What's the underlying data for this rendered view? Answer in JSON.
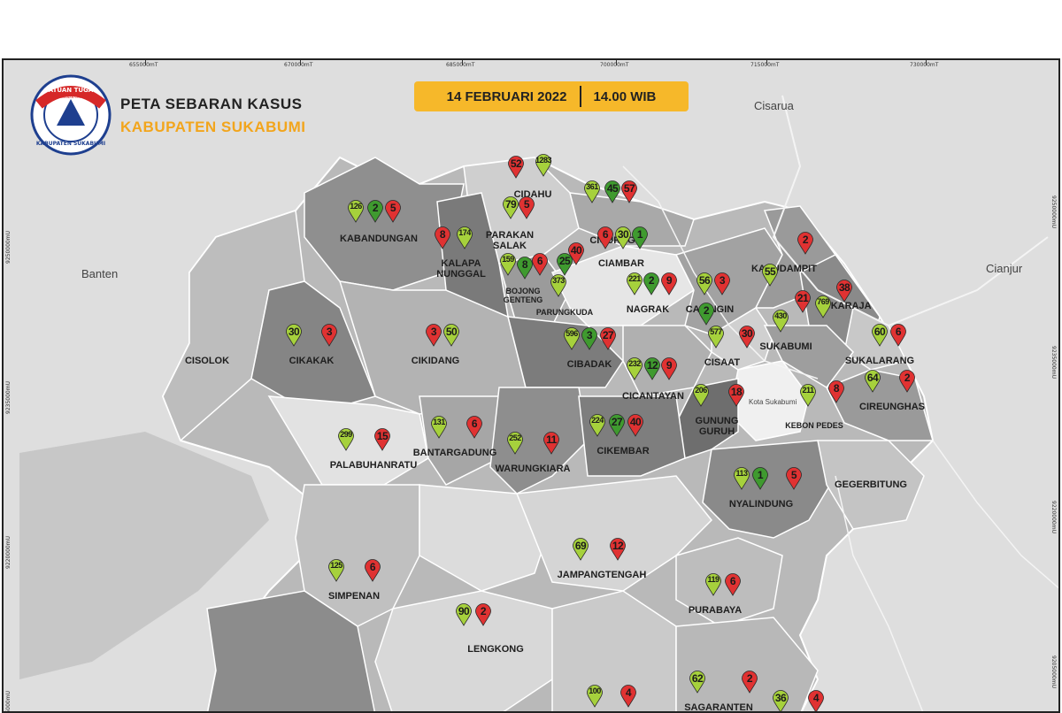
{
  "header": {
    "title": "PETA SEBARAN KASUS",
    "subtitle": "KABUPATEN SUKABUMI",
    "date": "14 FEBRUARI 2022",
    "time": "14.00 WIB"
  },
  "logo": {
    "ring_top": "SATUAN TUGAS",
    "ring_inner": "PENANGANAN COVID-19",
    "ring_bottom": "KABUPATEN SUKABUMI",
    "icon": "triangle-emblem-icon"
  },
  "grid_labels": {
    "top": [
      "655000mT",
      "670000mT",
      "685000mT",
      "700000mT",
      "715000mT",
      "730000mT"
    ],
    "left": [
      "9250000mU",
      "9235000mU",
      "9220000mU",
      "9205000mU"
    ],
    "right": [
      "9250000mU",
      "9235000mU",
      "9220000mU",
      "9205000mU"
    ]
  },
  "places": {
    "banten": "Banten",
    "cisarua": "Cisarua",
    "cianjur": "Cianjur",
    "kota_sukabumi": "Kota Sukabumi"
  },
  "legend_colors": {
    "green_light": "#a6d13c",
    "green_dark": "#3f9a2f",
    "red": "#e03232"
  },
  "districts": [
    {
      "name": "CIDAHU",
      "pins": [
        {
          "v": "52",
          "c": "red"
        },
        {
          "v": "1283",
          "c": "lime"
        }
      ]
    },
    {
      "name": "KABANDUNGAN",
      "pins": [
        {
          "v": "126",
          "c": "lime"
        },
        {
          "v": "2",
          "c": "green"
        },
        {
          "v": "5",
          "c": "red"
        }
      ]
    },
    {
      "name": "PARAKAN SALAK",
      "pins": [
        {
          "v": "79",
          "c": "lime"
        },
        {
          "v": "5",
          "c": "red"
        }
      ]
    },
    {
      "name": "CICURUG",
      "pins": [
        {
          "v": "361",
          "c": "lime"
        },
        {
          "v": "45",
          "c": "green"
        },
        {
          "v": "57",
          "c": "red"
        }
      ]
    },
    {
      "name": "KALAPA NUNGGAL",
      "pins": [
        {
          "v": "8",
          "c": "red"
        },
        {
          "v": "174",
          "c": "lime"
        }
      ]
    },
    {
      "name": "CIAMBAR",
      "pins": [
        {
          "v": "6",
          "c": "red"
        },
        {
          "v": "30",
          "c": "lime"
        },
        {
          "v": "1",
          "c": "green"
        }
      ]
    },
    {
      "name": "BOJONG GENTENG",
      "pins": [
        {
          "v": "159",
          "c": "lime"
        },
        {
          "v": "8",
          "c": "green"
        },
        {
          "v": "6",
          "c": "red"
        }
      ]
    },
    {
      "name": "PARUNGKUDA",
      "pins": [
        {
          "v": "25",
          "c": "green"
        },
        {
          "v": "40",
          "c": "red"
        },
        {
          "v": "373",
          "c": "lime"
        }
      ]
    },
    {
      "name": "KADUDAMPIT",
      "pins": [
        {
          "v": "2",
          "c": "red"
        },
        {
          "v": "55",
          "c": "lime"
        }
      ]
    },
    {
      "name": "NAGRAK",
      "pins": [
        {
          "v": "221",
          "c": "lime"
        },
        {
          "v": "2",
          "c": "green"
        },
        {
          "v": "9",
          "c": "red"
        }
      ]
    },
    {
      "name": "CARINGIN",
      "pins": [
        {
          "v": "56",
          "c": "lime"
        },
        {
          "v": "3",
          "c": "red"
        },
        {
          "v": "2",
          "c": "green"
        }
      ]
    },
    {
      "name": "SUKARAJA",
      "pins": [
        {
          "v": "21",
          "c": "red"
        },
        {
          "v": "769",
          "c": "lime"
        },
        {
          "v": "38",
          "c": "red"
        }
      ]
    },
    {
      "name": "CISOLOK",
      "pins": []
    },
    {
      "name": "CIKAKAK",
      "pins": [
        {
          "v": "30",
          "c": "lime"
        },
        {
          "v": "3",
          "c": "red"
        }
      ]
    },
    {
      "name": "CIKIDANG",
      "pins": [
        {
          "v": "3",
          "c": "red"
        },
        {
          "v": "50",
          "c": "lime"
        }
      ]
    },
    {
      "name": "CIBADAK",
      "pins": [
        {
          "v": "596",
          "c": "lime"
        },
        {
          "v": "3",
          "c": "green"
        },
        {
          "v": "27",
          "c": "red"
        }
      ]
    },
    {
      "name": "CISAAT",
      "pins": [
        {
          "v": "577",
          "c": "lime"
        },
        {
          "v": "30",
          "c": "red"
        }
      ]
    },
    {
      "name": "SUKABUMI",
      "pins": [
        {
          "v": "430",
          "c": "lime"
        }
      ]
    },
    {
      "name": "SUKALARANG",
      "pins": [
        {
          "v": "60",
          "c": "lime"
        },
        {
          "v": "6",
          "c": "red"
        }
      ]
    },
    {
      "name": "CICANTAYAN",
      "pins": [
        {
          "v": "232",
          "c": "lime"
        },
        {
          "v": "12",
          "c": "green"
        },
        {
          "v": "9",
          "c": "red"
        }
      ]
    },
    {
      "name": "GUNUNG GURUH",
      "pins": [
        {
          "v": "206",
          "c": "lime"
        },
        {
          "v": "18",
          "c": "red"
        }
      ]
    },
    {
      "name": "KEBON PEDES",
      "pins": [
        {
          "v": "211",
          "c": "lime"
        },
        {
          "v": "8",
          "c": "red"
        }
      ]
    },
    {
      "name": "CIREUNGHAS",
      "pins": [
        {
          "v": "64",
          "c": "lime"
        },
        {
          "v": "2",
          "c": "red"
        }
      ]
    },
    {
      "name": "PALABUHANRATU",
      "pins": [
        {
          "v": "299",
          "c": "lime"
        },
        {
          "v": "15",
          "c": "red"
        }
      ]
    },
    {
      "name": "BANTARGADUNG",
      "pins": [
        {
          "v": "131",
          "c": "lime"
        },
        {
          "v": "6",
          "c": "red"
        }
      ]
    },
    {
      "name": "WARUNGKIARA",
      "pins": [
        {
          "v": "252",
          "c": "lime"
        },
        {
          "v": "11",
          "c": "red"
        }
      ]
    },
    {
      "name": "CIKEMBAR",
      "pins": [
        {
          "v": "224",
          "c": "lime"
        },
        {
          "v": "27",
          "c": "green"
        },
        {
          "v": "40",
          "c": "red"
        }
      ]
    },
    {
      "name": "GEGERBITUNG",
      "pins": []
    },
    {
      "name": "NYALINDUNG",
      "pins": [
        {
          "v": "113",
          "c": "lime"
        },
        {
          "v": "1",
          "c": "green"
        },
        {
          "v": "5",
          "c": "red"
        }
      ]
    },
    {
      "name": "JAMPANGTENGAH",
      "pins": [
        {
          "v": "69",
          "c": "lime"
        },
        {
          "v": "12",
          "c": "red"
        }
      ]
    },
    {
      "name": "SIMPENAN",
      "pins": [
        {
          "v": "125",
          "c": "lime"
        },
        {
          "v": "6",
          "c": "red"
        }
      ]
    },
    {
      "name": "PURABAYA",
      "pins": [
        {
          "v": "119",
          "c": "lime"
        },
        {
          "v": "6",
          "c": "red"
        }
      ]
    },
    {
      "name": "LENGKONG",
      "pins": [
        {
          "v": "90",
          "c": "lime"
        },
        {
          "v": "2",
          "c": "red"
        }
      ]
    },
    {
      "name": "SAGARANTEN",
      "pins": [
        {
          "v": "62",
          "c": "lime"
        },
        {
          "v": "2",
          "c": "red"
        }
      ]
    }
  ],
  "partial_pins": [
    {
      "v": "100",
      "c": "lime"
    },
    {
      "v": "4",
      "c": "red"
    },
    {
      "v": "36",
      "c": "lime"
    },
    {
      "v": "4",
      "c": "red"
    }
  ]
}
